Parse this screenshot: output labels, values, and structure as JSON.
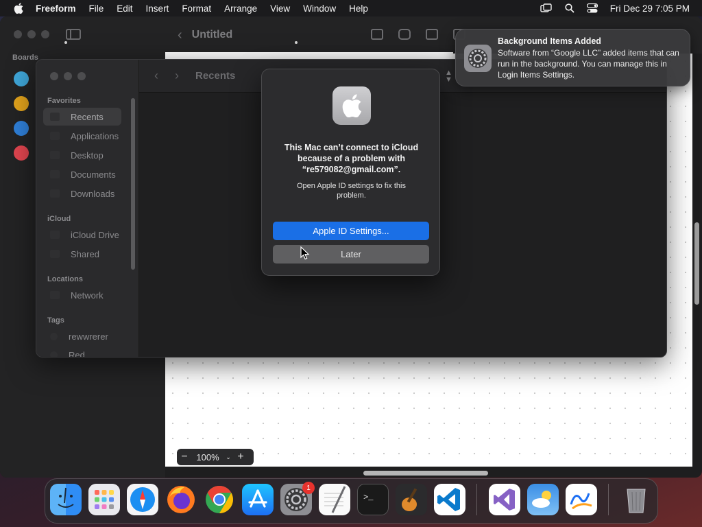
{
  "menubar": {
    "app_name": "Freeform",
    "items": [
      "File",
      "Edit",
      "Insert",
      "Format",
      "Arrange",
      "View",
      "Window",
      "Help"
    ],
    "clock": "Fri Dec 29  7:05 PM",
    "icons": [
      "apple-icon",
      "screen-mirroring-icon",
      "spotlight-icon",
      "control-center-icon"
    ]
  },
  "freeform": {
    "sidebar_heading": "Boards",
    "title": "Untitled",
    "zoom": "100%"
  },
  "finder": {
    "title": "Recents",
    "sidebar": {
      "favorites_heading": "Favorites",
      "favorites": [
        "Recents",
        "Applications",
        "Desktop",
        "Documents",
        "Downloads"
      ],
      "icloud_heading": "iCloud",
      "icloud": [
        "iCloud Drive",
        "Shared"
      ],
      "locations_heading": "Locations",
      "locations": [
        "Network"
      ],
      "tags_heading": "Tags",
      "tags": [
        "rewwrerer",
        "Red"
      ]
    }
  },
  "alert": {
    "title": "This Mac can’t connect to iCloud because of a problem with “re579082@gmail.com”.",
    "message": "Open Apple ID settings to fix this problem.",
    "primary_button": "Apple ID Settings...",
    "secondary_button": "Later"
  },
  "notification": {
    "title": "Background Items Added",
    "body": "Software from “Google LLC” added items that can run in the background. You can manage this in Login Items Settings."
  },
  "dock": {
    "apps": [
      "Finder",
      "Launchpad",
      "Safari",
      "Firefox",
      "Chrome",
      "App Store",
      "System Settings",
      "TextEdit",
      "Terminal",
      "GarageBand",
      "Visual Studio Code",
      "Visual Studio",
      "iCloud",
      "Freeform",
      "Trash"
    ],
    "system_settings_badge": "1",
    "colors": {
      "finder": "#2f8df5",
      "safari": "#1b8ef2",
      "chrome": "#34a853",
      "appstore": "#1d8ff3",
      "vscode": "#0a7acc",
      "visualstudio": "#8661c5"
    }
  }
}
